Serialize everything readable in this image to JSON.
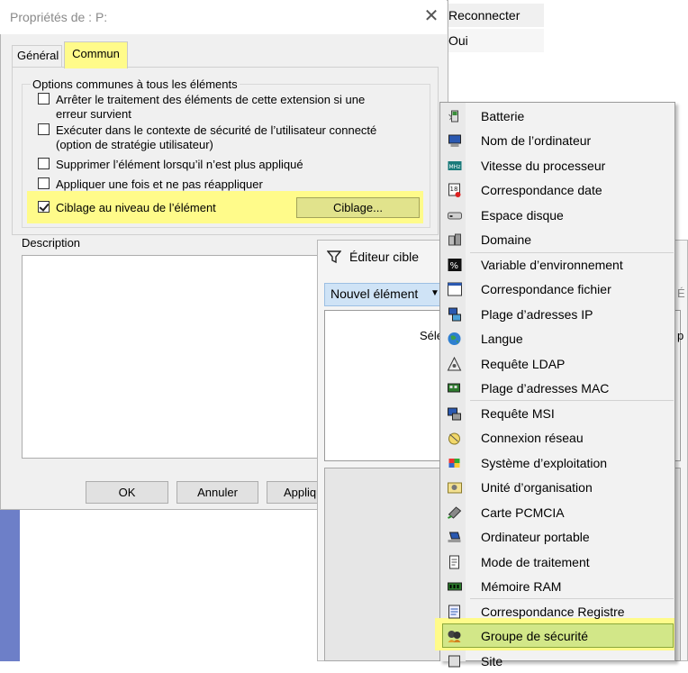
{
  "background": {
    "rows": [
      {
        "label": "Reconnecter"
      },
      {
        "label": "Oui"
      }
    ]
  },
  "properties_dialog": {
    "title": "Propriétés de : P:",
    "close_icon": "close-icon",
    "tabs": [
      {
        "label": "Général"
      },
      {
        "label": "Commun"
      }
    ],
    "group_title": "Options communes à tous les éléments",
    "options": [
      {
        "line1": "Arrêter le traitement des éléments de cette extension si une",
        "line2": "erreur survient",
        "checked": false
      },
      {
        "line1": "Exécuter dans le contexte de sécurité de l’utilisateur connecté",
        "line2": "(option de stratégie utilisateur)",
        "checked": false
      },
      {
        "line1": "Supprimer l’élément lorsqu’il n’est plus appliqué",
        "checked": false
      },
      {
        "line1": "Appliquer une fois et ne pas réappliquer",
        "checked": false
      },
      {
        "line1": "Ciblage au niveau de l’élément",
        "checked": true
      }
    ],
    "targeting_button": "Ciblage...",
    "description_label": "Description",
    "buttons": {
      "ok": "OK",
      "cancel": "Annuler",
      "apply": "Appliquer"
    },
    "highlight_color": "#fffb8a"
  },
  "target_editor": {
    "title": "Éditeur cible",
    "title_icon": "filter-icon",
    "new_item_button": "Nouvel élément",
    "fragment_left": "Séle",
    "fragment_right": "p",
    "fragment_right_top": "É"
  },
  "menu": {
    "items": [
      {
        "label": "Batterie",
        "icon": "battery-icon"
      },
      {
        "label": "Nom de l’ordinateur",
        "icon": "computer-icon"
      },
      {
        "label": "Vitesse du processeur",
        "icon": "cpu-icon"
      },
      {
        "label": "Correspondance date",
        "icon": "calendar-icon"
      },
      {
        "label": "Espace disque",
        "icon": "disk-icon"
      },
      {
        "label": "Domaine",
        "icon": "domain-icon"
      },
      {
        "label": "Variable d’environnement",
        "icon": "percent-icon"
      },
      {
        "label": "Correspondance fichier",
        "icon": "file-window-icon"
      },
      {
        "label": "Plage d’adresses IP",
        "icon": "network-icon"
      },
      {
        "label": "Langue",
        "icon": "globe-icon"
      },
      {
        "label": "Requête LDAP",
        "icon": "ldap-icon"
      },
      {
        "label": "Plage d’adresses MAC",
        "icon": "network-card-icon"
      },
      {
        "label": "Requête MSI",
        "icon": "msi-icon"
      },
      {
        "label": "Connexion réseau",
        "icon": "network-connection-icon"
      },
      {
        "label": "Système d’exploitation",
        "icon": "windows-icon"
      },
      {
        "label": "Unité d’organisation",
        "icon": "ou-icon"
      },
      {
        "label": "Carte PCMCIA",
        "icon": "pcmcia-icon"
      },
      {
        "label": "Ordinateur portable",
        "icon": "laptop-icon"
      },
      {
        "label": "Mode de traitement",
        "icon": "processing-mode-icon"
      },
      {
        "label": "Mémoire RAM",
        "icon": "ram-icon"
      },
      {
        "label": "Correspondance Registre",
        "icon": "registry-icon"
      },
      {
        "label": "Groupe de sécurité",
        "icon": "security-group-icon"
      },
      {
        "label": "Site",
        "icon": "site-icon"
      }
    ],
    "selected_label": "Groupe de sécurité",
    "selected_color": "#d2e788"
  }
}
